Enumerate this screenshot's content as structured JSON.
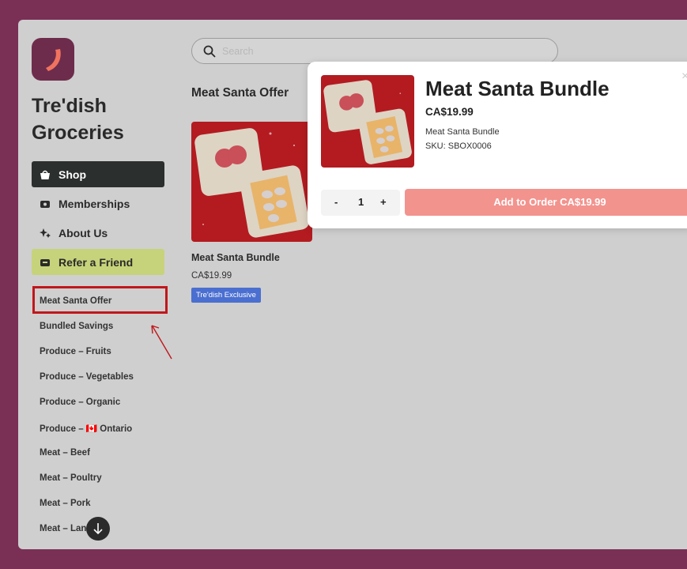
{
  "brand": {
    "name_line1": "Tre'dish",
    "name_line2": "Groceries"
  },
  "nav": {
    "shop": "Shop",
    "memberships": "Memberships",
    "about": "About Us",
    "refer": "Refer a Friend"
  },
  "categories": [
    "Meat Santa Offer",
    "Bundled Savings",
    "Produce – Fruits",
    "Produce – Vegetables",
    "Produce – Organic",
    "Produce – 🇨🇦 Ontario",
    "Meat – Beef",
    "Meat – Poultry",
    "Meat – Pork",
    "Meat – Lan"
  ],
  "search": {
    "placeholder": "Search"
  },
  "section": {
    "title": "Meat Santa Offer"
  },
  "product": {
    "name": "Meat Santa Bundle",
    "price": "CA$19.99",
    "badge": "Tre'dish Exclusive"
  },
  "modal": {
    "title": "Meat Santa Bundle",
    "price": "CA$19.99",
    "description": "Meat Santa Bundle",
    "sku": "SKU: SBOX0006",
    "close": "×",
    "qty_minus": "-",
    "qty_value": "1",
    "qty_plus": "+",
    "add_button": "Add to Order CA$19.99"
  },
  "colors": {
    "background": "#7a3055",
    "app_bg": "#cfcfcf",
    "shop_active": "#2b2f2d",
    "refer_bg": "#c7d37a",
    "badge": "#4a6fd0",
    "add_button": "#f3938e",
    "annotation": "#c0171c"
  }
}
